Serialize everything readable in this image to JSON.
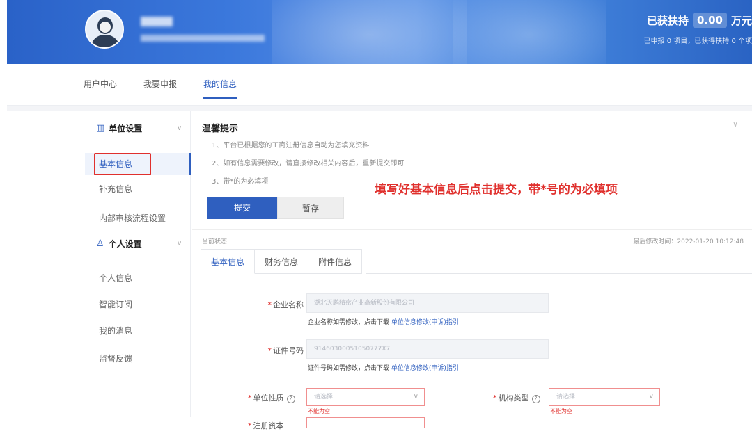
{
  "header": {
    "support_label": "已获扶持",
    "support_amount": "0.00",
    "support_unit": "万元",
    "support_summary": "已申报 0 项目，已获得扶持 0 个项"
  },
  "topnav": {
    "tabs": [
      {
        "label": "用户中心"
      },
      {
        "label": "我要申报"
      },
      {
        "label": "我的信息"
      }
    ],
    "active": "我的信息"
  },
  "sidebar": {
    "group1": "单位设置",
    "group1_items": [
      "基本信息",
      "补充信息",
      "内部审核流程设置"
    ],
    "group2": "个人设置",
    "group2_items": [
      "个人信息",
      "智能订阅",
      "我的消息",
      "监督反馈"
    ]
  },
  "tips": {
    "title": "温馨提示",
    "items": [
      "1、平台已根据您的工商注册信息自动为您填充资料",
      "2、如有信息需要修改，请直接修改相关内容后，重新提交即可",
      "3、带*的为必填项"
    ]
  },
  "annotation": "填写好基本信息后点击提交，带*号的为必填项",
  "buttons": {
    "submit": "提交",
    "save": "暂存"
  },
  "status_label": "当前状态:",
  "last_modified": "最后修改时间：2022-01-20 10:12:48",
  "subtabs": [
    "基本信息",
    "财务信息",
    "附件信息"
  ],
  "form": {
    "company_name_label": "企业名称",
    "company_name_value": "湖北天鹏精密产业高新股份有限公司",
    "company_name_hint": "企业名称如需修改，点击下载",
    "company_name_link": "单位信息修改(申诉)指引",
    "cert_label": "证件号码",
    "cert_value": "91460300051050777X7",
    "cert_hint": "证件号码如需修改，点击下载",
    "cert_link": "单位信息修改(申诉)指引",
    "nature_label": "单位性质",
    "nature_placeholder": "请选择",
    "nature_error": "不能为空",
    "org_type_label": "机构类型",
    "org_type_placeholder": "请选择",
    "org_type_error": "不能为空",
    "next_label": "注册资本"
  }
}
